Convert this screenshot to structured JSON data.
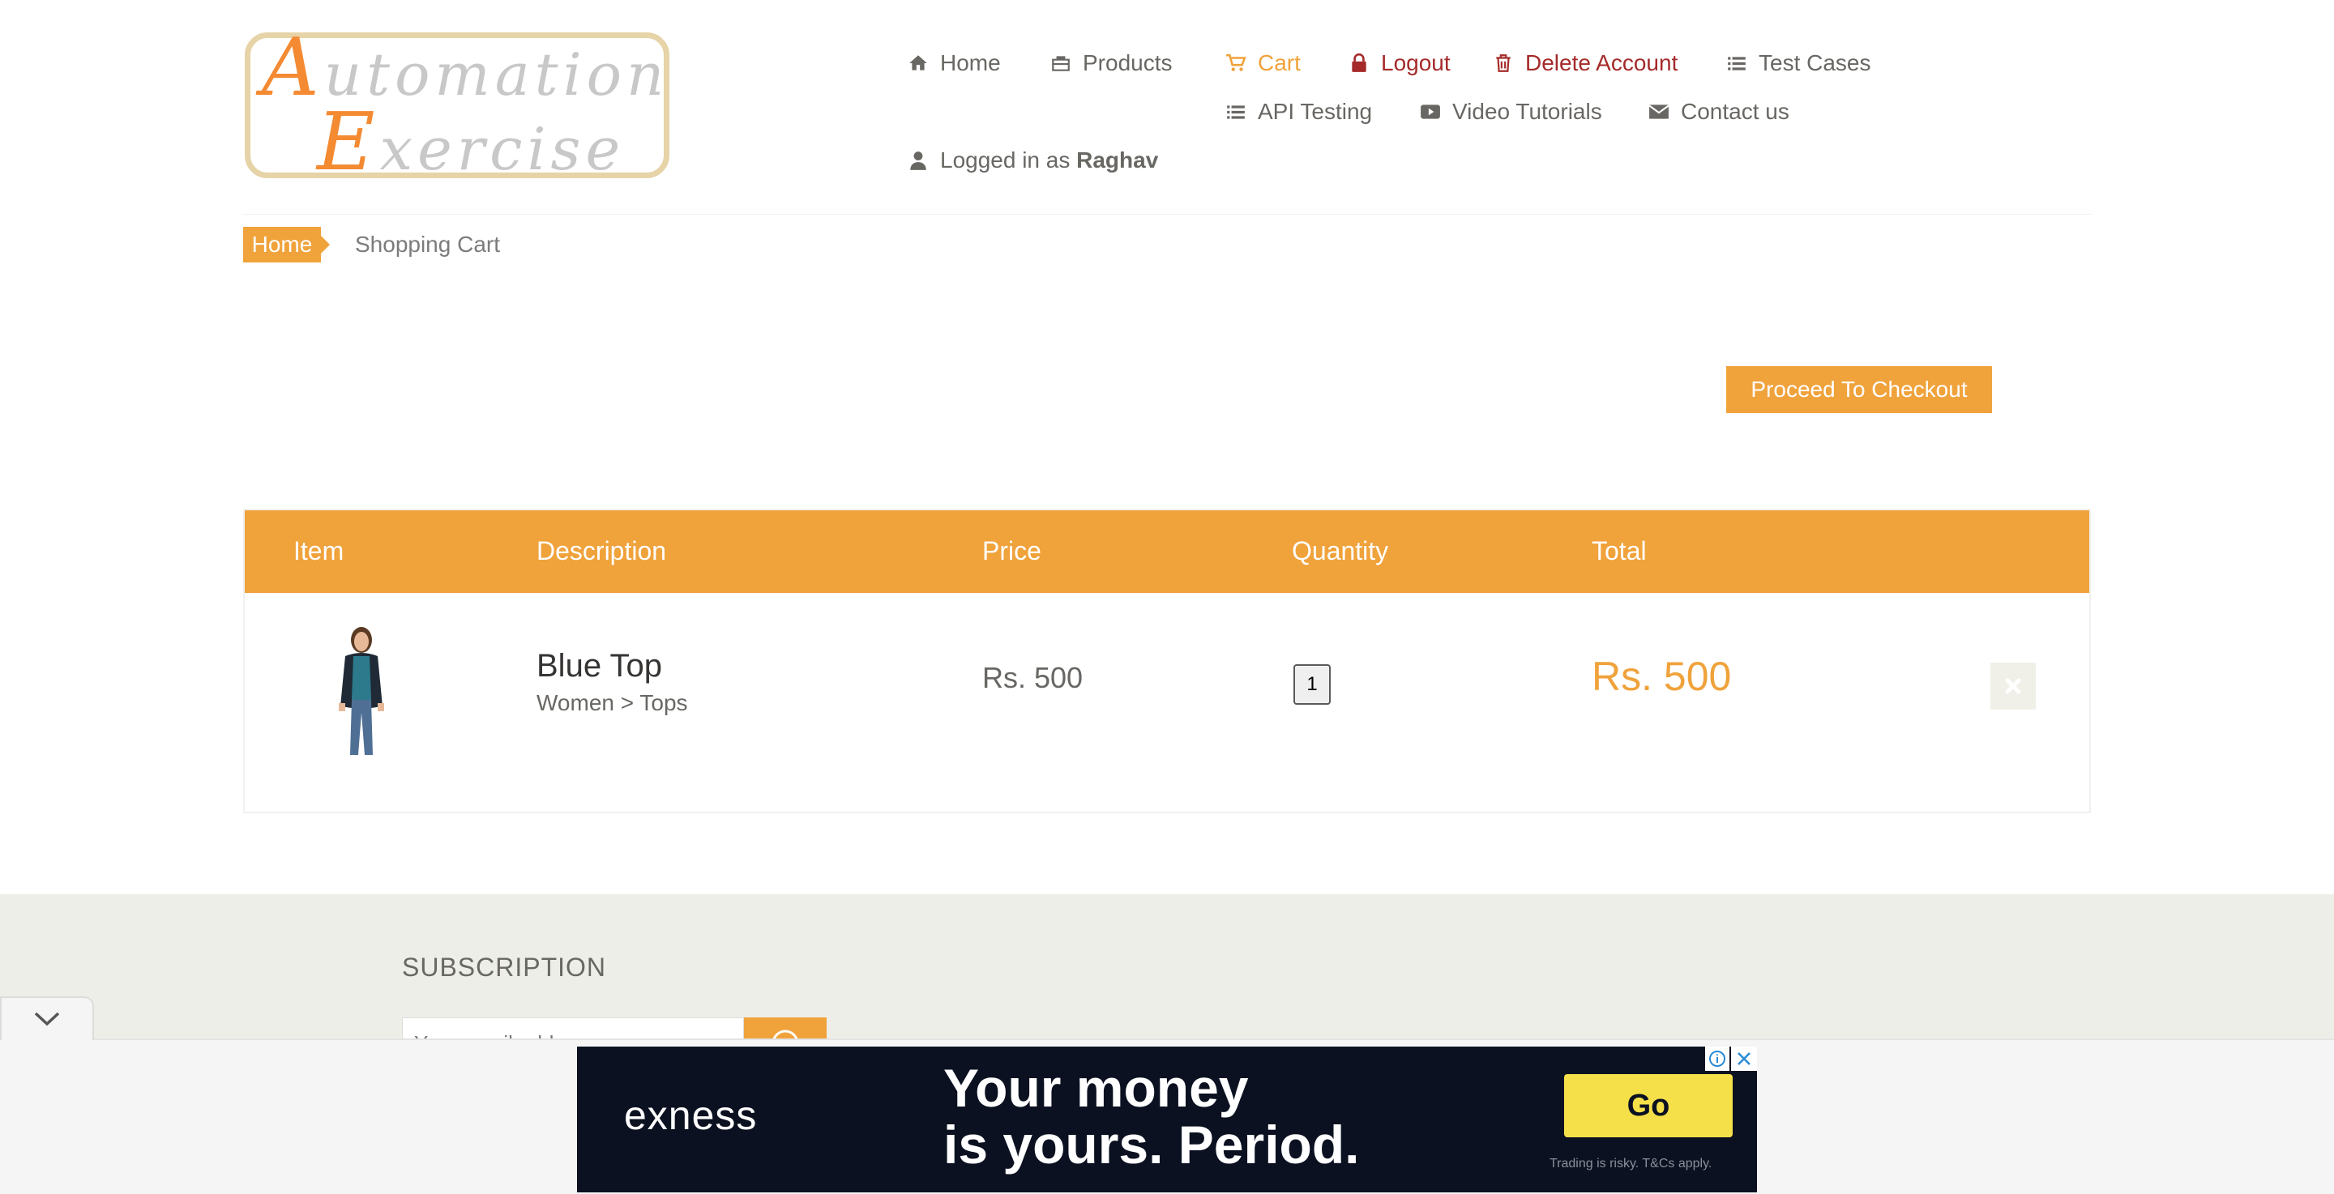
{
  "logo": {
    "line1_first": "A",
    "line1_rest": "utomation",
    "line2_first": "E",
    "line2_rest": "xercise"
  },
  "nav": {
    "home": "Home",
    "products": "Products",
    "cart": "Cart",
    "logout": "Logout",
    "delete_account": "Delete Account",
    "test_cases": "Test Cases",
    "api_testing": "API Testing",
    "video_tutorials": "Video Tutorials",
    "contact_us": "Contact us",
    "logged_in_prefix": "Logged in as ",
    "logged_in_user": "Raghav"
  },
  "breadcrumb": {
    "home": "Home",
    "current": "Shopping Cart"
  },
  "checkout_button": "Proceed To Checkout",
  "table": {
    "headers": [
      "Item",
      "Description",
      "Price",
      "Quantity",
      "Total"
    ],
    "rows": [
      {
        "name": "Blue Top",
        "category": "Women > Tops",
        "price": "Rs. 500",
        "quantity": "1",
        "total": "Rs. 500"
      }
    ]
  },
  "footer": {
    "subscription_title": "SUBSCRIPTION",
    "email_placeholder": "Your email address"
  },
  "ad": {
    "brand": "exness",
    "headline": "Your money\nis yours. Period.",
    "cta": "Go",
    "disclaimer": "Trading is risky. T&Cs apply."
  },
  "colors": {
    "accent": "#f0a23b",
    "danger": "#a52a2a",
    "text": "#696763",
    "footer_bg": "#eeeee8",
    "ad_bg": "#0b1121",
    "ad_cta": "#f6e04a"
  },
  "icons": {
    "home": "home-icon",
    "products": "briefcase-icon",
    "cart": "cart-icon",
    "logout": "lock-icon",
    "delete_account": "trash-icon",
    "test_cases": "list-icon",
    "api_testing": "list-icon",
    "video_tutorials": "youtube-icon",
    "contact_us": "envelope-icon",
    "user": "user-icon"
  }
}
